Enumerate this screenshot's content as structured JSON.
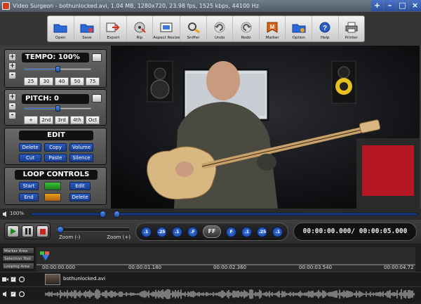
{
  "titlebar": {
    "title": "Video Surgeon - bothunlocked.avi, 1.04 MB, 1280x720, 23.98 fps, 1525 kbps, 44100 Hz",
    "buttons": [
      "+",
      "–",
      "□",
      "×"
    ]
  },
  "toolbar": {
    "buttons": [
      {
        "label": "Open",
        "icon": "folder-open-icon"
      },
      {
        "label": "Save",
        "icon": "folder-save-icon"
      },
      {
        "label": "Export",
        "icon": "export-icon"
      },
      {
        "label": "Rip",
        "icon": "rip-icon"
      },
      {
        "label": "Aspect Resize",
        "icon": "aspect-resize-icon"
      },
      {
        "label": "Sniffer",
        "icon": "sniffer-icon"
      },
      {
        "label": "Undo",
        "icon": "undo-icon"
      },
      {
        "label": "Redo",
        "icon": "redo-icon"
      },
      {
        "label": "Marker",
        "icon": "marker-icon"
      },
      {
        "label": "Option",
        "icon": "option-icon"
      },
      {
        "label": "Help",
        "icon": "help-icon"
      },
      {
        "label": "Printer",
        "icon": "printer-icon"
      }
    ]
  },
  "tempo": {
    "title": "TEMPO: 100%",
    "level": 0.5,
    "ticks": [
      "25",
      "30",
      "40",
      "50",
      "75"
    ]
  },
  "pitch": {
    "title": "PITCH: 0",
    "level": 0.5,
    "ticks": [
      "+",
      "2nd",
      "3rd",
      "4th",
      "Oct"
    ]
  },
  "edit": {
    "title": "EDIT",
    "buttons": [
      "Delete",
      "Copy",
      "Volume",
      "Cut",
      "Paste",
      "Silence"
    ]
  },
  "loop": {
    "title": "LOOP CONTROLS",
    "buttons": [
      "Start",
      "Edit",
      "End",
      "Delete"
    ]
  },
  "volume": {
    "label": "100%",
    "level": 1.0
  },
  "position": {
    "level": 0.0
  },
  "zoom": {
    "minus": "Zoom (-)",
    "plus": "Zoom (+)",
    "level": 0.0
  },
  "speed": {
    "buttons": [
      ".1",
      ".25",
      ".1",
      ".F",
      "FF",
      "F",
      ".1",
      ".25",
      ".1"
    ]
  },
  "timecode": {
    "current": "00:00:00.000",
    "separator": "/",
    "total": "00:00:05.000"
  },
  "timeline": {
    "labels": [
      "Marker Area",
      "Selection Tool",
      "Looping Area"
    ],
    "ticks": [
      "00:00:00.000",
      "00:00:01.180",
      "00:00:02.360",
      "00:00:03.540",
      "00:00:04.72"
    ],
    "clip_name": "bothunlocked.avi"
  },
  "colors": {
    "accent": "#2a5bc4",
    "panel": "#3d3d3d",
    "video_bg": "#0b0c0e"
  }
}
